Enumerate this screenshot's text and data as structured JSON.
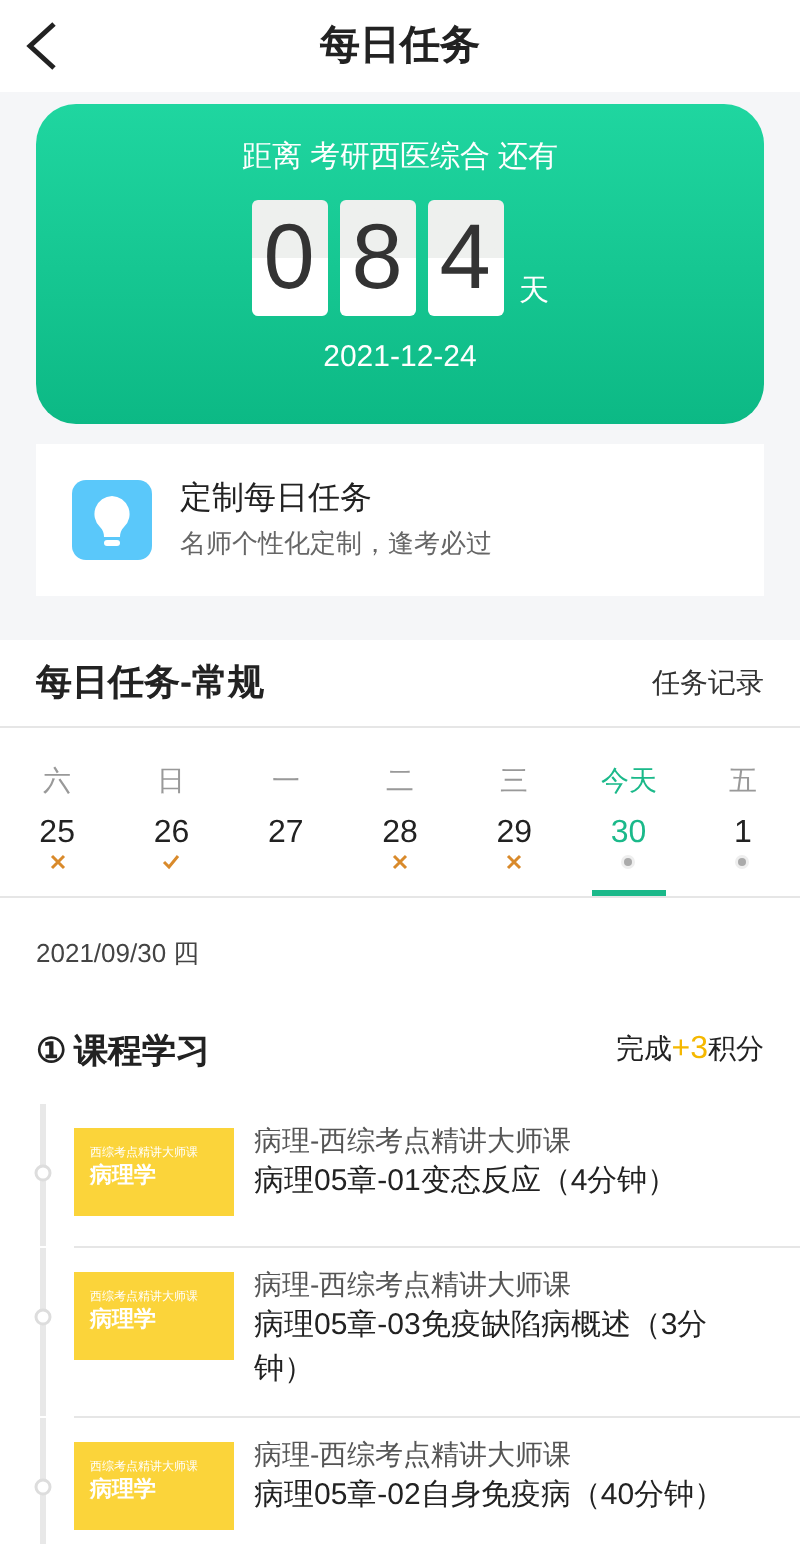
{
  "header": {
    "title": "每日任务"
  },
  "countdown": {
    "caption": "距离 考研西医综合 还有",
    "digits": [
      "0",
      "8",
      "4"
    ],
    "unit": "天",
    "date": "2021-12-24"
  },
  "promo": {
    "title": "定制每日任务",
    "subtitle": "名师个性化定制，逢考必过"
  },
  "section": {
    "title": "每日任务-常规",
    "link": "任务记录"
  },
  "days": [
    {
      "weekday": "六",
      "date": "25",
      "kind": "missed",
      "selected": false
    },
    {
      "weekday": "日",
      "date": "26",
      "kind": "done",
      "selected": false
    },
    {
      "weekday": "一",
      "date": "27",
      "kind": "none",
      "selected": false
    },
    {
      "weekday": "二",
      "date": "28",
      "kind": "missed",
      "selected": false
    },
    {
      "weekday": "三",
      "date": "29",
      "kind": "missed",
      "selected": false
    },
    {
      "weekday": "今天",
      "date": "30",
      "kind": "pending",
      "selected": true
    },
    {
      "weekday": "五",
      "date": "1",
      "kind": "pending",
      "selected": false
    }
  ],
  "current_date": "2021/09/30 四",
  "course": {
    "number": "①",
    "title": "课程学习",
    "reward_prefix": "完成",
    "reward_points": "+3",
    "reward_suffix": "积分"
  },
  "lessons": [
    {
      "thumb_caption": "西综考点精讲大师课",
      "thumb_title": "病理学",
      "course": "病理-西综考点精讲大师课",
      "title": "病理05章-01变态反应（4分钟）"
    },
    {
      "thumb_caption": "西综考点精讲大师课",
      "thumb_title": "病理学",
      "course": "病理-西综考点精讲大师课",
      "title": "病理05章-03免疫缺陷病概述（3分钟）"
    },
    {
      "thumb_caption": "西综考点精讲大师课",
      "thumb_title": "病理学",
      "course": "病理-西综考点精讲大师课",
      "title": "病理05章-02自身免疫病（40分钟）"
    }
  ]
}
